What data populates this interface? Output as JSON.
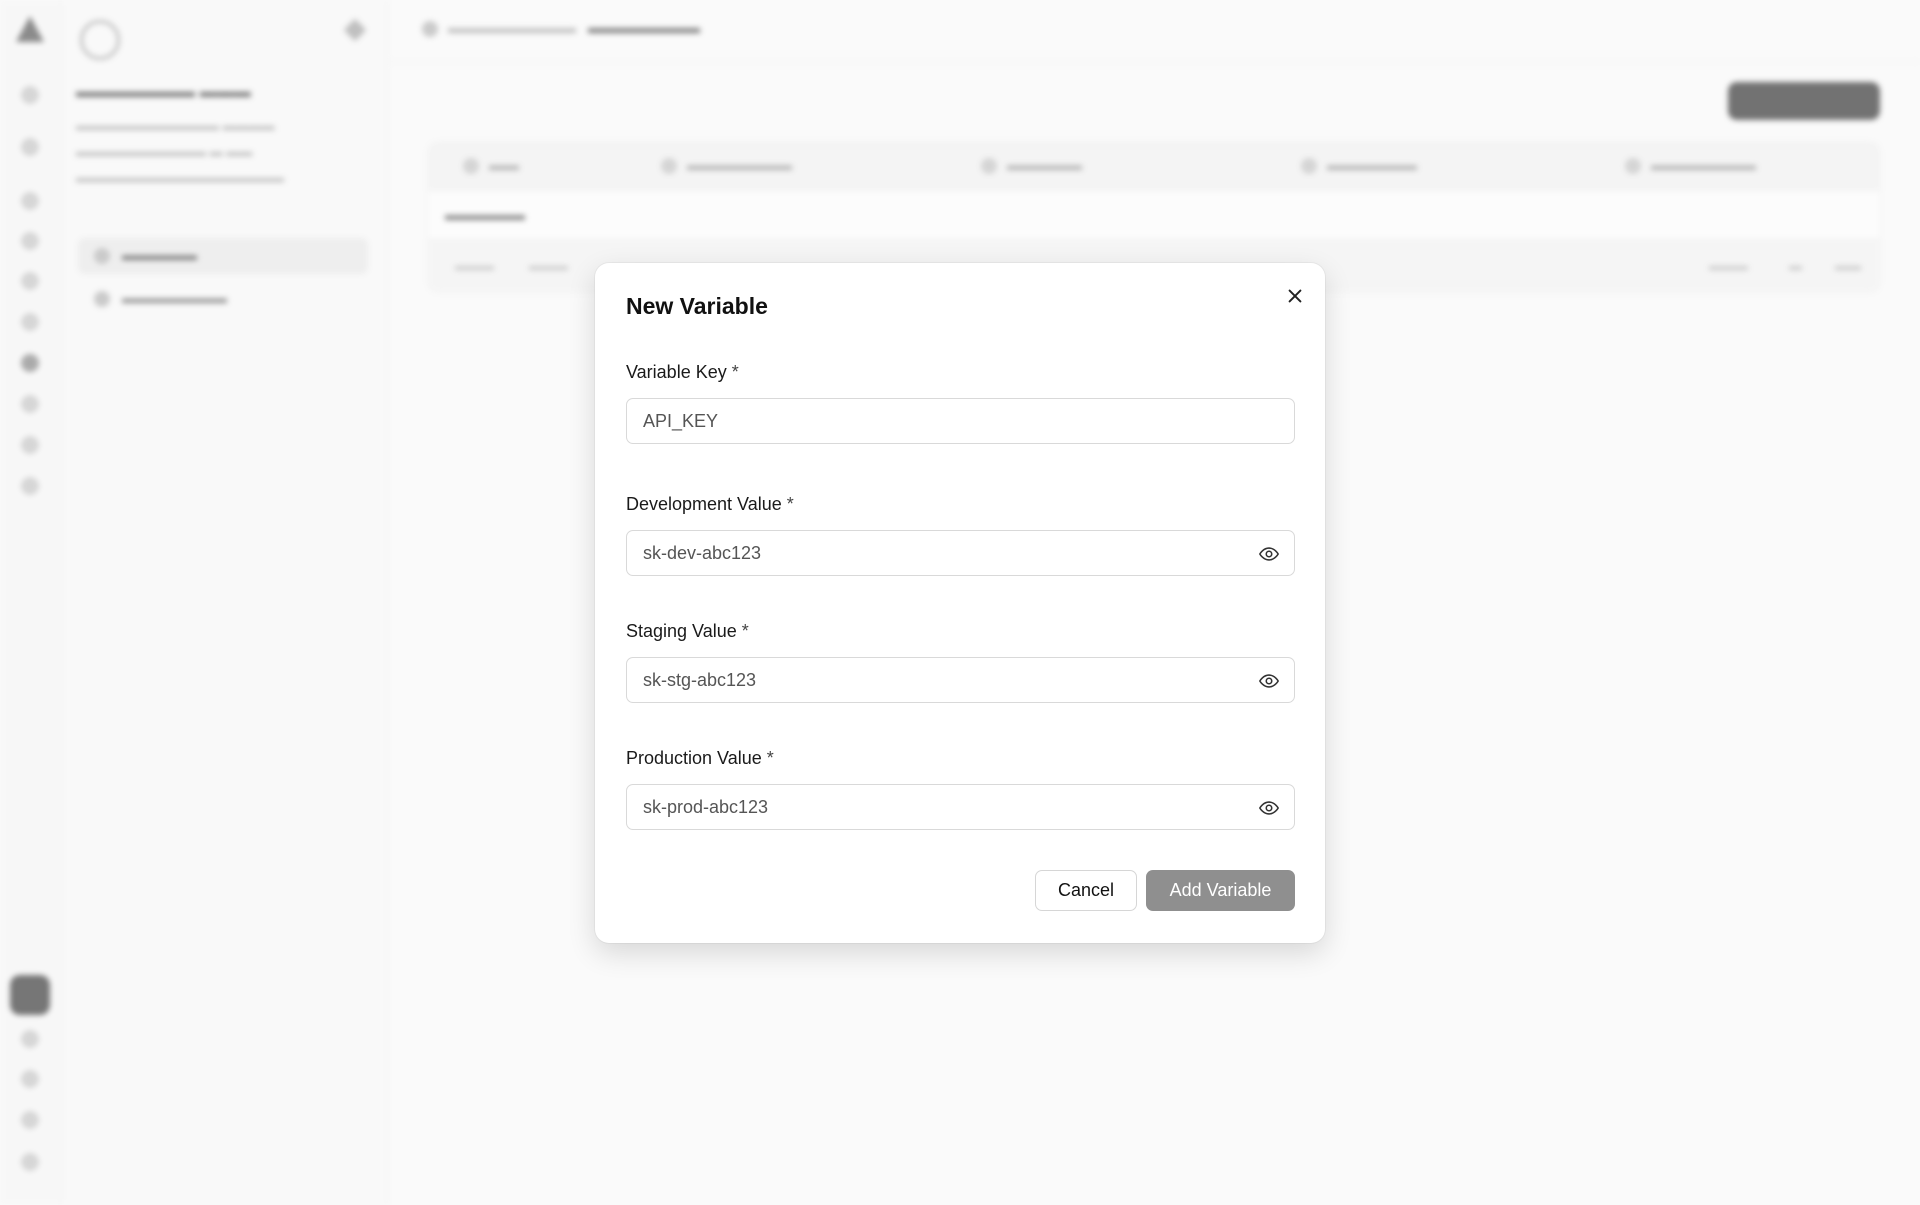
{
  "modal": {
    "title": "New Variable",
    "fields": [
      {
        "label": "Variable Key",
        "required": "*",
        "value": "API_KEY",
        "has_toggle": false
      },
      {
        "label": "Development Value",
        "required": "*",
        "value": "sk-dev-abc123",
        "has_toggle": true
      },
      {
        "label": "Staging Value",
        "required": "*",
        "value": "sk-stg-abc123",
        "has_toggle": true
      },
      {
        "label": "Production Value",
        "required": "*",
        "value": "sk-prod-abc123",
        "has_toggle": true
      }
    ],
    "cancel_label": "Cancel",
    "submit_label": "Add Variable"
  },
  "icons": {
    "close": "close-icon",
    "reveal": "eye-icon"
  },
  "colors": {
    "submit_disabled": "#8f8f8f",
    "border": "#d9d9d9"
  }
}
